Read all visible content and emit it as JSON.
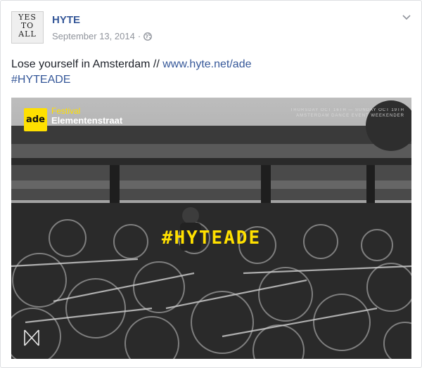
{
  "post": {
    "author": "HYTE",
    "avatar_text": "YES TO ALL",
    "date": "September 13, 2014",
    "privacy_icon": "globe-icon",
    "menu_icon": "chevron-down-icon",
    "text_main": "Lose yourself in Amsterdam // ",
    "link": "www.hyte.net/ade",
    "hashtag": "#HYTEADE"
  },
  "image": {
    "badge": "ade",
    "festival": "Festival",
    "street": "Elementenstraat",
    "overlay_tag": "#HYTEADE",
    "dates": "THURSDAY OCT 16TH — SUNDAY OCT 19TH\nAMSTERDAM DANCE EVENT WEEKENDER"
  },
  "colors": {
    "link": "#365899",
    "accent": "#ffe000",
    "meta": "#90949c"
  }
}
